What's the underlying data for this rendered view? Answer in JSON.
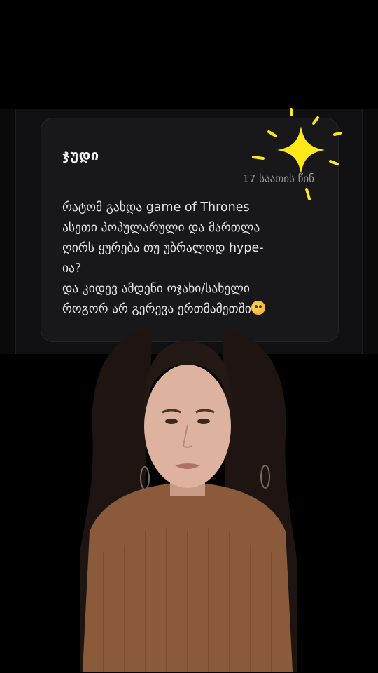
{
  "post": {
    "author": "ჯუდი",
    "timestamp": "17 საათის წინ",
    "question": "რატომ გახდა game of Thrones\nასეთი პოპულარული და მართლა\nღირს ყურება თუ უბრალოდ hype-\nია?\nდა კიდევ ამდენი ოჯახი/სახელი\nროგორ არ გერევა ერთმამეთში",
    "emoji": "worried-face-emoji"
  },
  "decorations": {
    "sparkle_color": "#ffe81a",
    "sparkle_icon": "sparkle-star-icon"
  },
  "video": {
    "subject": "person-speaking"
  },
  "colors": {
    "background": "#000000",
    "card": "#18181b",
    "text": "#e6e6e8",
    "muted": "#9a9aa0"
  }
}
